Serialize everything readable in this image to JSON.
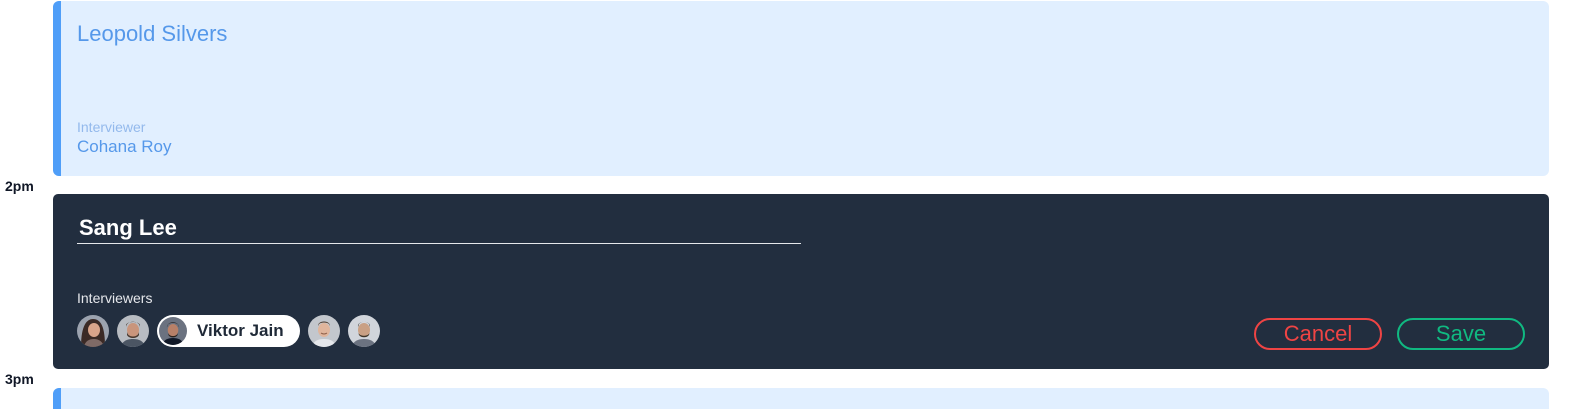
{
  "timeline": {
    "labels": [
      "2pm",
      "3pm"
    ]
  },
  "events": [
    {
      "candidate": "Leopold Silvers",
      "role_label": "Interviewer",
      "role_value": "Cohana Roy"
    }
  ],
  "editor": {
    "candidate_value": "Sang Lee",
    "interviewers_label": "Interviewers",
    "selected_interviewer": "Viktor Jain",
    "cancel_label": "Cancel",
    "save_label": "Save"
  },
  "colors": {
    "event_bg": "#e1efff",
    "event_accent": "#4f9ef8",
    "editor_bg": "#222e3f",
    "cancel": "#ef4444",
    "save": "#10b981"
  }
}
